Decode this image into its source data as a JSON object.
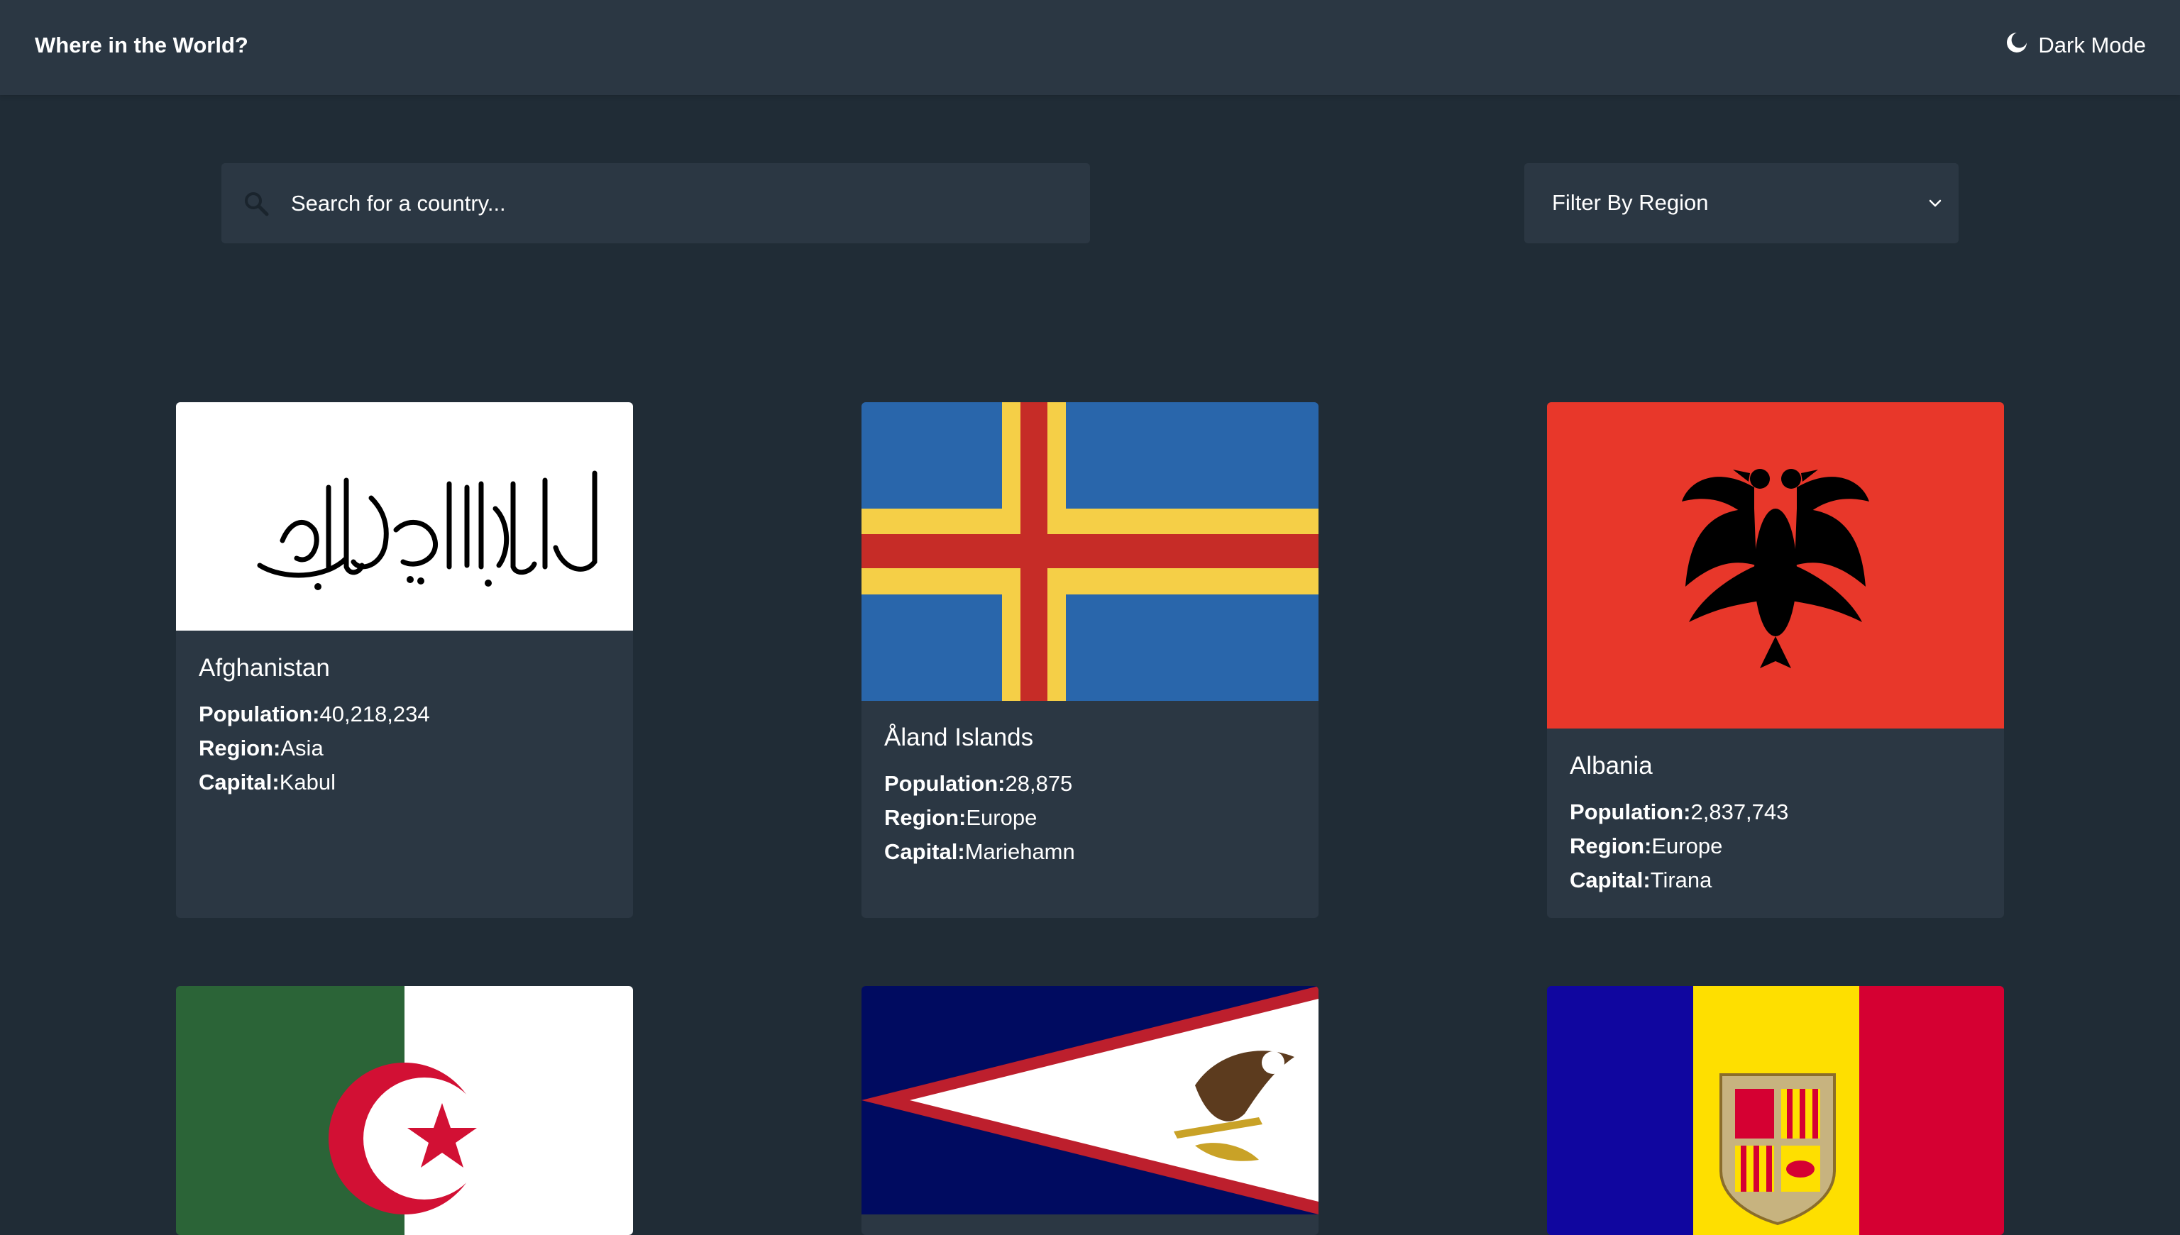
{
  "header": {
    "title": "Where in the World?",
    "theme_toggle_label": "Dark Mode",
    "theme_icon": "moon-icon"
  },
  "search": {
    "placeholder": "Search for a country...",
    "value": "",
    "icon": "search-icon"
  },
  "filter": {
    "label": "Filter By Region",
    "icon": "chevron-down-icon"
  },
  "labels": {
    "population": "Population:",
    "region": "Region:",
    "capital": "Capital:"
  },
  "countries": [
    {
      "name": "Afghanistan",
      "population": "40,218,234",
      "region": "Asia",
      "capital": "Kabul",
      "flag": "afghanistan-flag"
    },
    {
      "name": "Åland Islands",
      "population": "28,875",
      "region": "Europe",
      "capital": "Mariehamn",
      "flag": "aland-islands-flag"
    },
    {
      "name": "Albania",
      "population": "2,837,743",
      "region": "Europe",
      "capital": "Tirana",
      "flag": "albania-flag"
    },
    {
      "name": "",
      "population": "",
      "region": "",
      "capital": "",
      "flag": "algeria-flag"
    },
    {
      "name": "",
      "population": "",
      "region": "",
      "capital": "",
      "flag": "american-samoa-flag"
    },
    {
      "name": "",
      "population": "",
      "region": "",
      "capital": "",
      "flag": "andorra-flag"
    }
  ],
  "colors": {
    "background": "#202c36",
    "surface": "#2b3743",
    "text": "#ffffff"
  }
}
